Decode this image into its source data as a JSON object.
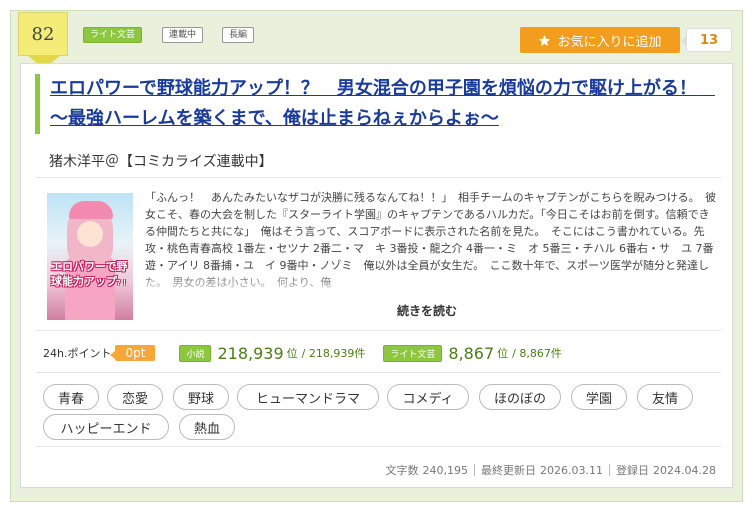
{
  "rank": "82",
  "tags": {
    "genre": "ライト文芸",
    "status": "連載中",
    "length": "長編"
  },
  "favorite": {
    "label": "お気に入りに追加",
    "icon": "star-icon",
    "count": "13"
  },
  "title": "エロパワーで野球能力アップ！？　男女混合の甲子園を煩悩の力で駆け上がる！　～最強ハーレムを築くまで、俺は止まらねぇからよぉ～",
  "author": "猪木洋平＠【コミカライズ連載中】",
  "cover": {
    "title_main": "エロパワーで野球能力アップ",
    "title_small": "？！"
  },
  "synopsis": "「ふんっ！　あんたみたいなザコが決勝に残るなんてね！！」　相手チームのキャプテンがこちらを睨みつける。　彼女こそ、春の大会を制した『スターライト学園』のキャプテンであるハルカだ。「今日こそはお前を倒す。信頼できる仲間たちと共にな」　俺はそう言って、スコアボードに表示された名前を見た。　そこにはこう書かれている。先攻・桃色青春高校 1番左・セツナ 2番二・マ　キ 3番投・龍之介 4番一・ミ　オ 5番三・チハル 6番右・サ　ユ 7番遊・アイリ 8番捕・ユ　イ 9番中・ノゾミ　俺以外は全員が女生だ。　ここ数十年で、スポーツ医学が随分と発達した。　男女の差は小さい。　何より、俺",
  "read_more": "続きを読む",
  "points": {
    "label": "24h.ポイント",
    "value": "0pt"
  },
  "rankings": [
    {
      "tag": "小説",
      "rank": "218,939",
      "unit": "位",
      "total": "/ 218,939件"
    },
    {
      "tag": "ライト文芸",
      "rank": "8,867",
      "unit": "位",
      "total": "/ 8,867件"
    }
  ],
  "keywords": [
    "青春",
    "恋愛",
    "野球",
    "ヒューマンドラマ",
    "コメディ",
    "ほのぼの",
    "学園",
    "友情",
    "ハッピーエンド",
    "熱血"
  ],
  "meta": {
    "chars_label": "文字数",
    "chars": "240,195",
    "updated_label": "最終更新日",
    "updated": "2026.03.11",
    "registered_label": "登録日",
    "registered": "2024.04.28"
  },
  "colors": {
    "accent_green": "#8dc63f",
    "favorite_orange": "#f29d1e",
    "title_blue": "#1a3a9c",
    "frame_bg": "#e9f1dc"
  }
}
